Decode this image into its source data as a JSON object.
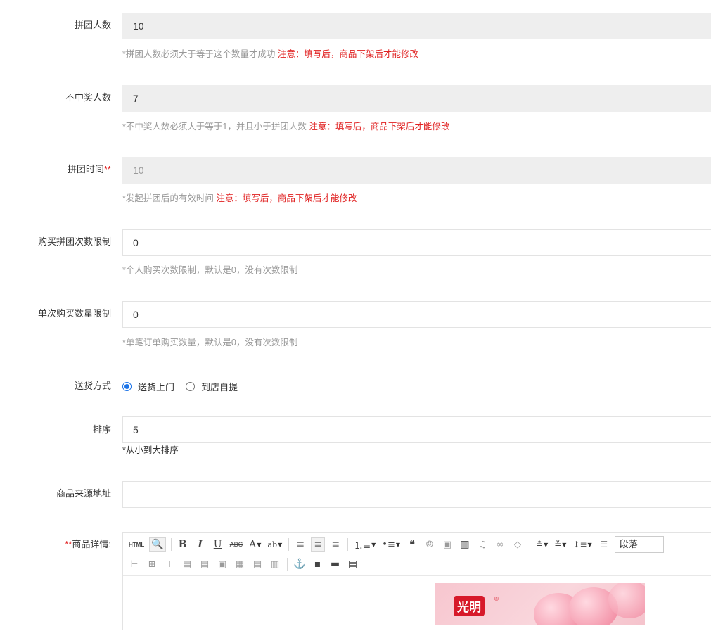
{
  "fields": {
    "group_size": {
      "label": "拼团人数",
      "value": "10",
      "hint": "*拼团人数必须大于等于这个数量才成功",
      "warning": "注意：填写后，商品下架后才能修改"
    },
    "non_winner_count": {
      "label": "不中奖人数",
      "value": "7",
      "hint": "*不中奖人数必须大于等于1，并且小于拼团人数",
      "warning": "注意：填写后，商品下架后才能修改"
    },
    "group_time": {
      "label": "拼团时间",
      "required_mark": "**",
      "value": "10",
      "hint": "*发起拼团后的有效时间",
      "warning": "注意：填写后，商品下架后才能修改"
    },
    "purchase_limit": {
      "label": "购买拼团次数限制",
      "value": "0",
      "hint": "*个人购买次数限制，默认是0，没有次数限制"
    },
    "single_qty_limit": {
      "label": "单次购买数量限制",
      "value": "0",
      "hint": "*单笔订单购买数量，默认是0，没有次数限制"
    },
    "delivery": {
      "label": "送货方式",
      "options": [
        "送货上门",
        "到店自提"
      ],
      "selected": "送货上门"
    },
    "sort": {
      "label": "排序",
      "value": "5",
      "hint": "*从小到大排序"
    },
    "source_url": {
      "label": "商品来源地址",
      "value": ""
    },
    "details": {
      "required_mark": "**",
      "label": "商品详情:",
      "paragraph_select": "段落",
      "toolbar_html": "HTML"
    }
  },
  "promo_image": {
    "brand": "光明",
    "registered": "®"
  },
  "colors": {
    "warning": "#e02020",
    "radio_accent": "#1a73e8",
    "disabled_bg": "#eeeeee"
  }
}
